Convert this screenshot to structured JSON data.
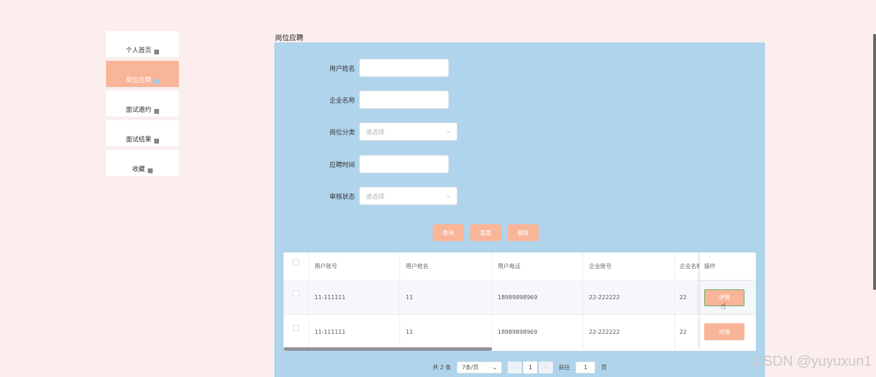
{
  "sidebar": {
    "items": [
      {
        "label": "个人首页",
        "active": false
      },
      {
        "label": "岗位应聘",
        "active": true
      },
      {
        "label": "面试邀约",
        "active": false
      },
      {
        "label": "面试结果",
        "active": false
      },
      {
        "label": "收藏",
        "active": false
      }
    ]
  },
  "page": {
    "title": "岗位应聘"
  },
  "form": {
    "user_name_label": "用户姓名",
    "company_name_label": "企业名称",
    "job_category_label": "岗位分类",
    "job_category_placeholder": "请选择",
    "apply_time_label": "应聘时间",
    "review_status_label": "审核状态",
    "review_status_placeholder": "请选择"
  },
  "buttons": {
    "search": "查询",
    "reset": "重置",
    "delete": "删除"
  },
  "table": {
    "headers": [
      "用户账号",
      "用户姓名",
      "用户电话",
      "企业账号",
      "企业名称",
      "操作"
    ],
    "rows": [
      {
        "user_account": "11-111111",
        "user_name": "11",
        "phone": "18989898969",
        "company_account": "22-222222",
        "company_name": "22",
        "action": "详情"
      },
      {
        "user_account": "11-111111",
        "user_name": "11",
        "phone": "18989898969",
        "company_account": "22-222222",
        "company_name": "22",
        "action": "详情"
      }
    ]
  },
  "pager": {
    "total": "共 2 条",
    "page_size": "7条/页",
    "prev": "‹",
    "current": "1",
    "next": "›",
    "goto_label": "前往",
    "goto_value": "1",
    "page_unit": "页"
  },
  "watermark": "CSDN @yuyuxun1",
  "colors": {
    "accent": "#f9b598",
    "panel": "#b0d4eb",
    "background": "#fdeeee"
  }
}
